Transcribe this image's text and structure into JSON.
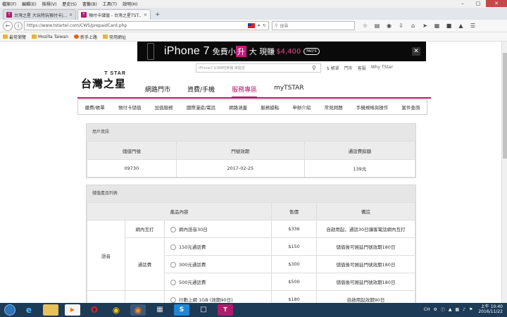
{
  "browser": {
    "menu": [
      "檔案(F)",
      "編輯(E)",
      "檢視(V)",
      "歷史(S)",
      "書籤(B)",
      "工具(T)",
      "說明(H)"
    ],
    "tabs": [
      {
        "title": "台灣之星 大玩特玩預付卡|...",
        "active": false
      },
      {
        "title": "預付卡儲值 - 台灣之星TST...",
        "active": true
      }
    ],
    "url": "https://www.tstartel.com/CWS/prepaidCard.php",
    "search_placeholder": "搜尋",
    "bookmarks": [
      "最常瀏覽",
      "Mozilla Taiwan",
      "新手上路",
      "常用網址"
    ]
  },
  "banner": {
    "text_main": "iPhone 7",
    "text_free": "免費小",
    "text_hl": "升",
    "text_big": "大 現賺",
    "price": "$4,400",
    "pill": "FAQ'S"
  },
  "header": {
    "logo_top": "T STAR",
    "logo_main": "台灣之星",
    "search_placeholder": "iPhone7 $388吃到飽 家庭省",
    "toplinks": [
      "$ 帳單",
      "門市",
      "客服",
      "Why TStar"
    ],
    "nav": [
      "網路門市",
      "資費/手機",
      "服務專區",
      "myTSTAR"
    ],
    "nav_active": "服務專區"
  },
  "subnav": [
    "繳費/帳單",
    "預付卡儲值",
    "加值服務",
    "國際漫遊/電話",
    "網路涵蓋",
    "服務據點",
    "申辦介紹",
    "常見問題",
    "手機規格與操作",
    "案件查詢"
  ],
  "account": {
    "title": "用戶資訊",
    "headers": [
      "儲值門號",
      "門號效期",
      "通話費餘額"
    ],
    "row": [
      "09730",
      "2017-02-25",
      "139元"
    ]
  },
  "products": {
    "title": "儲值產品列表",
    "headers": [
      "產品內容",
      "售價",
      "備註"
    ],
    "group1": "語音",
    "sub1": "網內互打",
    "sub2": "通話費",
    "sub3": "",
    "items": [
      {
        "name": "網內語音30日",
        "price": "$336",
        "note": "自啟用起，通話30日讓客電話網內互打"
      },
      {
        "name": "150元通話費",
        "price": "$150",
        "note": "儲值後可展延門號效期180日"
      },
      {
        "name": "300元通話費",
        "price": "$300",
        "note": "儲值後可展延門號效期180日"
      },
      {
        "name": "500元通話費",
        "price": "$500",
        "note": "儲值後可展延門號效期180日"
      },
      {
        "name": "行動上網 1GB (效期90日)",
        "price": "$180",
        "note": "自啟用起效期90日"
      }
    ]
  },
  "taskbar": {
    "lang": "CH",
    "time": "上午 10:40",
    "date": "2016/11/22"
  }
}
